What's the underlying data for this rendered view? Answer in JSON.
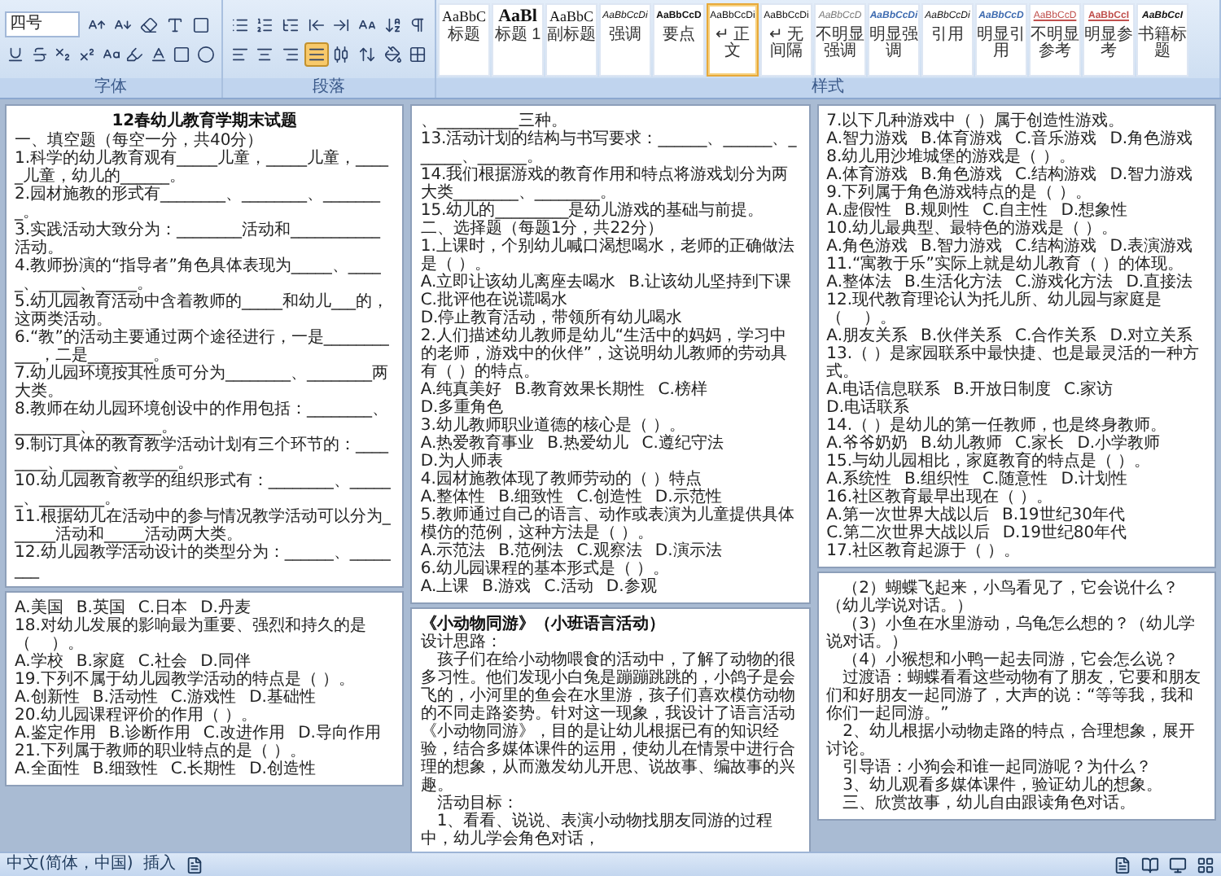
{
  "ribbon": {
    "font_group": {
      "label": "字体",
      "font_size": "四号"
    },
    "paragraph_group": {
      "label": "段落",
      "align_buttons": [
        {
          "selected": false
        },
        {
          "selected": false
        },
        {
          "selected": false
        },
        {
          "selected": true
        },
        {
          "selected": false
        }
      ]
    },
    "styles_group": {
      "label": "样式",
      "styles": [
        {
          "sample": "AaBbC",
          "label": "标题",
          "selected": false
        },
        {
          "sample": "AaBl",
          "label": "标题 1",
          "selected": false
        },
        {
          "sample": "AaBbC",
          "label": "副标题",
          "selected": false
        },
        {
          "sample": "AaBbCcDi",
          "label": "强调",
          "selected": false
        },
        {
          "sample": "AaBbCcD",
          "label": "要点",
          "selected": false
        },
        {
          "sample": "AaBbCcDi",
          "label": "↵ 正文",
          "selected": true
        },
        {
          "sample": "AaBbCcDi",
          "label": "↵ 无间隔",
          "selected": false
        },
        {
          "sample": "AaBbCcD",
          "label": "不明显强调",
          "selected": false
        },
        {
          "sample": "AaBbCcDi",
          "label": "明显强调",
          "selected": false
        },
        {
          "sample": "AaBbCcDi",
          "label": "引用",
          "selected": false
        },
        {
          "sample": "AaBbCcD",
          "label": "明显引用",
          "selected": false
        },
        {
          "sample": "AaBbCcD",
          "label": "不明显参考",
          "selected": false
        },
        {
          "sample": "AaBbCcI",
          "label": "明显参考",
          "selected": false
        },
        {
          "sample": "AaBbCcI",
          "label": "书籍标题",
          "selected": false
        }
      ]
    }
  },
  "pages": [
    {
      "blocks": [
        {
          "kind": "title",
          "text": "12春幼儿教育学期末试题"
        },
        {
          "kind": "line",
          "text": "一、填空题（每空一分，共40分）"
        },
        {
          "kind": "line",
          "text": "1.科学的幼儿教育观有_____儿童，_____儿童，_____儿童，幼儿的______。"
        },
        {
          "kind": "line",
          "text": "2.园材施教的形式有________、________、________。"
        },
        {
          "kind": "line",
          "text": "3.实践活动大致分为：________活动和___________活动。"
        },
        {
          "kind": "line",
          "text": "4.教师扮演的“指导者”角色具体表现为_____、_____、_____、_____。"
        },
        {
          "kind": "line",
          "text": "5.幼儿园教育活动中含着教师的_____和幼儿___的，这两类活动。"
        },
        {
          "kind": "line",
          "text": "6.“教”的活动主要通过两个途径进行，一是___________，二是________。"
        },
        {
          "kind": "line",
          "text": "7.幼儿园环境按其性质可分为________、________两大类。"
        },
        {
          "kind": "line",
          "text": "8.教师在幼儿园环境创设中的作用包括：________、________、________。"
        },
        {
          "kind": "line",
          "text": "9.制订具体的教育教学活动计划有三个环节的：________、______、______。"
        },
        {
          "kind": "line",
          "text": "10.幼儿园教育教学的组织形式有：________、______、________。"
        },
        {
          "kind": "line",
          "text": "11.根据幼儿在活动中的参与情况教学活动可以分为______活动和_____活动两大类。"
        },
        {
          "kind": "line",
          "text": "12.幼儿园教学活动设计的类型分为：______、________"
        }
      ]
    },
    {
      "blocks": [
        {
          "kind": "line",
          "text": "、__________三种。"
        },
        {
          "kind": "line",
          "text": "13.活动计划的结构与书写要求：______、______、______、______。"
        },
        {
          "kind": "line",
          "text": "14.我们根据游戏的教育作用和特点将游戏划分为两大类________、________。"
        },
        {
          "kind": "line",
          "text": "15.幼儿的_________是幼儿游戏的基础与前提。"
        },
        {
          "kind": "line",
          "text": "二、选择题（每题1分，共22分）"
        },
        {
          "kind": "line",
          "text": "1.上课时，个别幼儿喊口渴想喝水，老师的正确做法是（    ）。"
        },
        {
          "kind": "options",
          "options": [
            "A.立即让该幼儿离座去喝水",
            "B.让该幼儿坚持到下课"
          ]
        },
        {
          "kind": "options",
          "options": [
            "C.批评他在说谎喝水",
            "D.停止教育活动，带领所有幼儿喝水"
          ]
        },
        {
          "kind": "line",
          "text": "2.人们描述幼儿教师是幼儿“生活中的妈妈，学习中的老师，游戏中的伙伴”，这说明幼儿教师的劳动具有（     ）的特点。"
        },
        {
          "kind": "options",
          "options": [
            "A.纯真美好",
            "B.教育效果长期性",
            "C.榜样",
            "D.多重角色"
          ]
        },
        {
          "kind": "line",
          "text": "3.幼儿教师职业道德的核心是（    ）。"
        },
        {
          "kind": "options",
          "options": [
            "A.热爱教育事业",
            "B.热爱幼儿",
            "C.遵纪守法",
            "D.为人师表"
          ]
        },
        {
          "kind": "line",
          "text": "4.园材施教体现了教师劳动的（    ）特点"
        },
        {
          "kind": "options",
          "options": [
            "A.整体性",
            "B.细致性",
            "C.创造性",
            "D.示范性"
          ]
        },
        {
          "kind": "line",
          "text": "5.教师通过自己的语言、动作或表演为儿童提供具体模仿的范例，这种方法是（    ）。"
        },
        {
          "kind": "options",
          "options": [
            "A.示范法",
            "B.范例法",
            "C.观察法",
            "D.演示法"
          ]
        },
        {
          "kind": "line",
          "text": "6.幼儿园课程的基本形式是（    ）。"
        },
        {
          "kind": "options",
          "options": [
            "A.上课",
            "B.游戏",
            "C.活动",
            "D.参观"
          ]
        }
      ]
    },
    {
      "blocks": [
        {
          "kind": "line",
          "text": "7.以下几种游戏中（    ）属于创造性游戏。"
        },
        {
          "kind": "options",
          "options": [
            "A.智力游戏",
            "B.体育游戏",
            "C.音乐游戏",
            "D.角色游戏"
          ]
        },
        {
          "kind": "line",
          "text": "8.幼儿用沙堆城堡的游戏是（    ）。"
        },
        {
          "kind": "options",
          "options": [
            "A.体育游戏",
            "B.角色游戏",
            "C.结构游戏",
            "D.智力游戏"
          ]
        },
        {
          "kind": "line",
          "text": "9.下列属于角色游戏特点的是（    ）。"
        },
        {
          "kind": "options",
          "options": [
            "A.虚假性",
            "B.规则性",
            "C.自主性",
            "D.想象性"
          ]
        },
        {
          "kind": "line",
          "text": "10.幼儿最典型、最特色的游戏是（    ）。"
        },
        {
          "kind": "options",
          "options": [
            "A.角色游戏",
            "B.智力游戏",
            "C.结构游戏",
            "D.表演游戏"
          ]
        },
        {
          "kind": "line",
          "text": "11.“寓教于乐”实际上就是幼儿教育（    ）的体现。"
        },
        {
          "kind": "options",
          "options": [
            "A.整体法",
            "B.生活化方法",
            "C.游戏化方法",
            "D.直接法"
          ]
        },
        {
          "kind": "line",
          "text": "12.现代教育理论认为托儿所、幼儿园与家庭是（    ）。"
        },
        {
          "kind": "options",
          "options": [
            "A.朋友关系",
            "B.伙伴关系",
            "C.合作关系",
            "D.对立关系"
          ]
        },
        {
          "kind": "line",
          "text": "13.（    ）是家园联系中最快捷、也是最灵活的一种方式。"
        },
        {
          "kind": "options",
          "options": [
            "A.电话信息联系",
            "B.开放日制度",
            "C.家访",
            "D.电话联系"
          ]
        },
        {
          "kind": "line",
          "text": "14.（    ）是幼儿的第一任教师，也是终身教师。"
        },
        {
          "kind": "options",
          "options": [
            "A.爷爷奶奶",
            "B.幼儿教师",
            "C.家长",
            "D.小学教师"
          ]
        },
        {
          "kind": "line",
          "text": "15.与幼儿园相比，家庭教育的特点是（    ）。"
        },
        {
          "kind": "options",
          "options": [
            "A.系统性",
            "B.组织性",
            "C.随意性",
            "D.计划性"
          ]
        },
        {
          "kind": "line",
          "text": "16.社区教育最早出现在（    ）。"
        },
        {
          "kind": "options",
          "options": [
            "A.第一次世界大战以后",
            "B.19世纪30年代"
          ]
        },
        {
          "kind": "options",
          "options": [
            "C.第二次世界大战以后",
            "D.19世纪80年代"
          ]
        },
        {
          "kind": "line",
          "text": "17.社区教育起源于（    ）。"
        }
      ]
    },
    {
      "blocks": [
        {
          "kind": "options",
          "options": [
            "A.美国",
            "B.英国",
            "C.日本",
            "D.丹麦"
          ]
        },
        {
          "kind": "line",
          "text": "18.对幼儿发展的影响最为重要、强烈和持久的是（    ）。"
        },
        {
          "kind": "options",
          "options": [
            "A.学校",
            "B.家庭",
            "C.社会",
            "D.同伴"
          ]
        },
        {
          "kind": "line",
          "text": "19.下列不属于幼儿园教学活动的特点是（    ）。"
        },
        {
          "kind": "options",
          "options": [
            "A.创新性",
            "B.活动性",
            "C.游戏性",
            "D.基础性"
          ]
        },
        {
          "kind": "line",
          "text": "20.幼儿园课程评价的作用（    ）。"
        },
        {
          "kind": "options",
          "options": [
            "A.鉴定作用",
            "B.诊断作用",
            "C.改进作用",
            "D.导向作用"
          ]
        },
        {
          "kind": "line",
          "text": "21.下列属于教师的职业特点的是（    ）。"
        },
        {
          "kind": "options",
          "options": [
            "A.全面性",
            "B.细致性",
            "C.长期性",
            "D.创造性"
          ]
        }
      ]
    },
    {
      "blocks": [
        {
          "kind": "heading",
          "text": "《小动物同游》（小班语言活动）"
        },
        {
          "kind": "line",
          "text": "设计思路："
        },
        {
          "kind": "para",
          "text": "孩子们在给小动物喂食的活动中，了解了动物的很多习性。他们发现小白兔是蹦蹦跳跳的，小鸽子是会飞的，小河里的鱼会在水里游，孩子们喜欢模仿动物的不同走路姿势。针对这一现象，我设计了语言活动《小动物同游》，目的是让幼儿根据已有的知识经验，结合多媒体课件的运用，使幼儿在情景中进行合理的想象，从而激发幼儿开思、说故事、编故事的兴趣。"
        },
        {
          "kind": "para",
          "text": "活动目标："
        },
        {
          "kind": "para",
          "text": "1、看看、说说、表演小动物找朋友同游的过程中，幼儿学会角色对话，"
        }
      ]
    },
    {
      "blocks": [
        {
          "kind": "para",
          "text": "（2）蝴蝶飞起来，小鸟看见了，它会说什么？（幼儿学说对话。）"
        },
        {
          "kind": "para",
          "text": "（3）小鱼在水里游动，乌龟怎么想的？（幼儿学说对话。）"
        },
        {
          "kind": "para",
          "text": "（4）小猴想和小鸭一起去同游，它会怎么说？"
        },
        {
          "kind": "para",
          "text": "过渡语：蝴蝶看看这些动物有了朋友，它要和朋友们和好朋友一起同游了，大声的说：“等等我，我和你们一起同游。”"
        },
        {
          "kind": "para",
          "text": "2、幼儿根据小动物走路的特点，合理想象，展开讨论。"
        },
        {
          "kind": "para",
          "text": "引导语：小狗会和谁一起同游呢？为什么？"
        },
        {
          "kind": "para",
          "text": "3、幼儿观看多媒体课件，验证幼儿的想象。"
        },
        {
          "kind": "para",
          "text": "三、欣赏故事，幼儿自由跟读角色对话。"
        }
      ]
    }
  ],
  "status_bar": {
    "language": "中文(简体，中国)",
    "mode": "插入"
  }
}
